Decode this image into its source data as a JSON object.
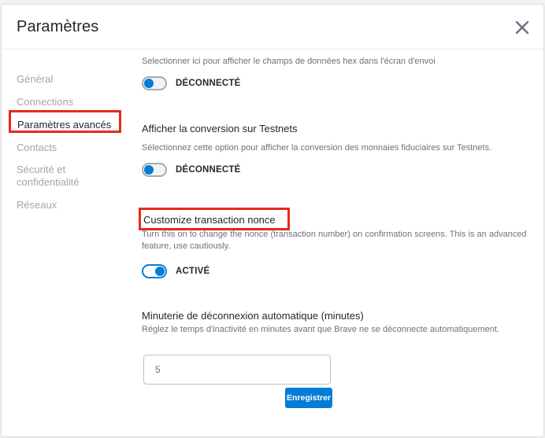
{
  "dialog": {
    "title": "Paramètres",
    "close_icon": "close-icon"
  },
  "sidebar": {
    "items": [
      {
        "label": "Général",
        "active": false
      },
      {
        "label": "Connections",
        "active": false
      },
      {
        "label": "Paramètres avancés",
        "active": true
      },
      {
        "label": "Contacts",
        "active": false
      },
      {
        "label": "Sécurité et confidentialité",
        "active": false
      },
      {
        "label": "Réseaux",
        "active": false
      }
    ]
  },
  "settings": {
    "hex_data": {
      "description": "Selectionner ici pour afficher le champs de données hex dans l'écran d'envoi",
      "toggle_on": false,
      "state_label": "DÉCONNECTÉ"
    },
    "testnet_conversion": {
      "title": "Afficher la conversion sur Testnets",
      "description": "Sélectionnez cette option pour afficher la conversion des monnaies fiduciaires sur Testnets.",
      "toggle_on": false,
      "state_label": "DÉCONNECTÉ"
    },
    "custom_nonce": {
      "title": "Customize transaction nonce",
      "description": "Turn this on to change the nonce (transaction number) on confirmation screens. This is an advanced feature, use cautiously.",
      "toggle_on": true,
      "state_label": "ACTIVÉ"
    },
    "auto_logout": {
      "title": "Minuterie de déconnexion automatique (minutes)",
      "description": "Réglez le temps d'inactivité en minutes avant que Brave ne se déconnecte automatiquement.",
      "value": "5",
      "save_label": "Enregistrer"
    }
  },
  "colors": {
    "accent": "#037dd6",
    "highlight": "#e8291c",
    "text_primary": "#24292e",
    "text_muted": "#9fa6ae"
  }
}
